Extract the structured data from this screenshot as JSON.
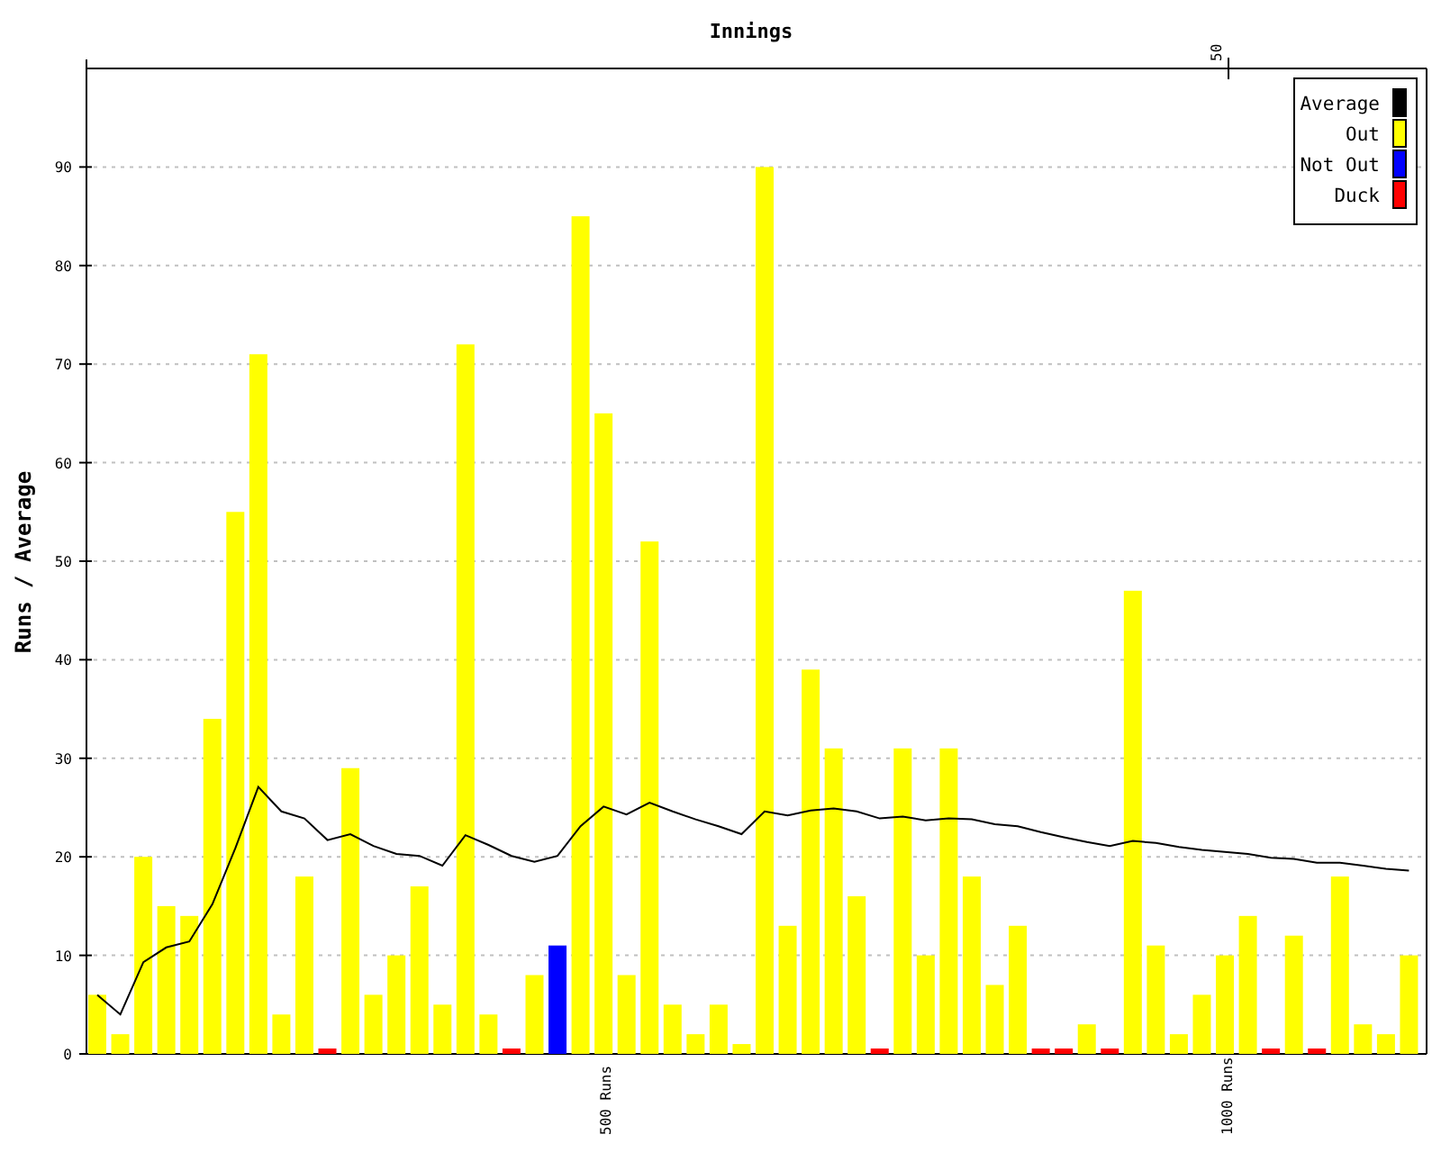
{
  "chart_data": {
    "type": "bar",
    "title": "Innings",
    "ylabel": "Runs / Average",
    "ylim": [
      0,
      100
    ],
    "yticks": [
      {
        "value": 0,
        "label": "0"
      },
      {
        "value": 10,
        "label": "10"
      },
      {
        "value": 20,
        "label": "20"
      },
      {
        "value": 30,
        "label": "30"
      },
      {
        "value": 40,
        "label": "40"
      },
      {
        "value": 50,
        "label": "50"
      },
      {
        "value": 60,
        "label": "60"
      },
      {
        "value": 70,
        "label": "70"
      },
      {
        "value": 80,
        "label": "80"
      },
      {
        "value": 90,
        "label": "90"
      }
    ],
    "grid": true,
    "legend": true,
    "series": [
      {
        "name": "Average",
        "color": "#000000",
        "type": "line",
        "values": [
          6,
          4,
          9.3,
          10.8,
          11.4,
          15.2,
          20.9,
          27.1,
          24.6,
          23.9,
          21.7,
          22.3,
          21.1,
          20.3,
          20.1,
          19.1,
          22.2,
          21.2,
          20.1,
          19.5,
          20.1,
          23.1,
          25.1,
          24.3,
          25.5,
          24.6,
          23.8,
          23.1,
          22.3,
          24.6,
          24.2,
          24.7,
          24.9,
          24.6,
          23.9,
          24.1,
          23.7,
          23.9,
          23.8,
          23.3,
          23.1,
          22.5,
          22,
          21.5,
          21.1,
          21.6,
          21.4,
          21,
          20.7,
          20.5,
          20.3,
          19.9,
          19.8,
          19.4,
          19.4,
          19.1,
          18.8,
          18.6
        ]
      },
      {
        "name": "Out",
        "color": "#ffff00",
        "type": "bar",
        "values": [
          6,
          2,
          20,
          15,
          14,
          34,
          55,
          71,
          4,
          18,
          null,
          29,
          6,
          10,
          17,
          5,
          72,
          4,
          null,
          8,
          null,
          85,
          65,
          8,
          52,
          5,
          2,
          5,
          1,
          90,
          13,
          39,
          31,
          16,
          null,
          31,
          10,
          31,
          18,
          7,
          13,
          null,
          null,
          3,
          null,
          47,
          11,
          2,
          6,
          10,
          14,
          null,
          12,
          null,
          18,
          3,
          2,
          10
        ]
      },
      {
        "name": "Not Out",
        "color": "#0000ff",
        "type": "bar",
        "values": [
          null,
          null,
          null,
          null,
          null,
          null,
          null,
          null,
          null,
          null,
          null,
          null,
          null,
          null,
          null,
          null,
          null,
          null,
          null,
          null,
          11,
          null,
          null,
          null,
          null,
          null,
          null,
          null,
          null,
          null,
          null,
          null,
          null,
          null,
          null,
          null,
          null,
          null,
          null,
          null,
          null,
          null,
          null,
          null,
          null,
          null,
          null,
          null,
          null,
          null,
          null,
          null,
          null,
          null,
          null,
          null,
          null,
          null
        ]
      },
      {
        "name": "Duck",
        "color": "#ff0000",
        "type": "bar",
        "values": [
          null,
          null,
          null,
          null,
          null,
          null,
          null,
          null,
          null,
          null,
          0,
          null,
          null,
          null,
          null,
          null,
          null,
          null,
          0,
          null,
          null,
          null,
          null,
          null,
          null,
          null,
          null,
          null,
          null,
          null,
          null,
          null,
          null,
          null,
          0,
          null,
          null,
          null,
          null,
          null,
          null,
          0,
          0,
          null,
          0,
          null,
          null,
          null,
          null,
          null,
          null,
          0,
          null,
          0,
          null,
          null,
          null,
          null
        ]
      }
    ],
    "annotations": [
      "500 Runs",
      "1000 Runs"
    ]
  },
  "top_axis_label": "50"
}
